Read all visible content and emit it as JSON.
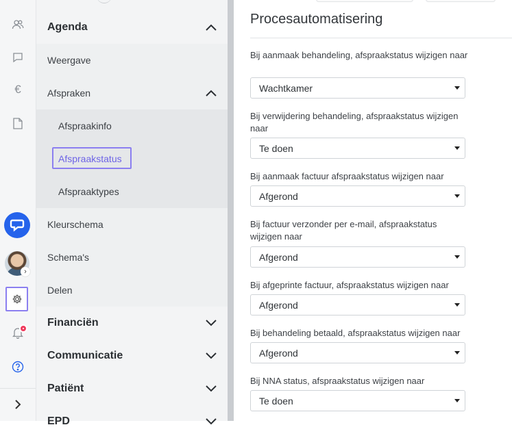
{
  "rail": {
    "icons": [
      "users-icon",
      "chat-bubble-icon",
      "euro-icon",
      "document-icon"
    ],
    "bottom_icons": [
      "chat-logo-icon",
      "avatar",
      "gear-icon",
      "bell-icon",
      "help-icon",
      "expand-chevron-icon"
    ],
    "accent": "#2563eb",
    "badge_color": "#ef3b5d"
  },
  "nav": {
    "agenda": "Agenda",
    "weergave": "Weergave",
    "afspraken": "Afspraken",
    "afspraakinfo": "Afspraakinfo",
    "afspraakstatus": "Afspraakstatus",
    "afspraaktypes": "Afspraaktypes",
    "kleurschema": "Kleurschema",
    "schemas": "Schema's",
    "delen": "Delen",
    "financien": "Financiën",
    "communicatie": "Communicatie",
    "patient": "Patiënt",
    "epd": "EPD",
    "highlight_color": "#8b7ff0"
  },
  "content": {
    "title": "Procesautomatisering",
    "fields": [
      {
        "label": "Bij aanmaak behandeling, afspraakstatus wijzigen naar",
        "value": "Wachtkamer"
      },
      {
        "label": "Bij verwijdering behandeling, afspraakstatus wijzigen naar",
        "value": "Te doen"
      },
      {
        "label": "Bij aanmaak factuur afspraakstatus wijzigen naar",
        "value": "Afgerond"
      },
      {
        "label": "Bij factuur verzonder per e-mail, afspraakstatus wijzigen naar",
        "value": "Afgerond"
      },
      {
        "label": "Bij afgeprinte factuur, afspraakstatus wijzigen naar",
        "value": "Afgerond"
      },
      {
        "label": "Bij behandeling betaald, afspraakstatus wijzigen naar",
        "value": "Afgerond"
      },
      {
        "label": "Bij NNA status, afspraakstatus wijzigen naar",
        "value": "Te doen"
      }
    ]
  }
}
